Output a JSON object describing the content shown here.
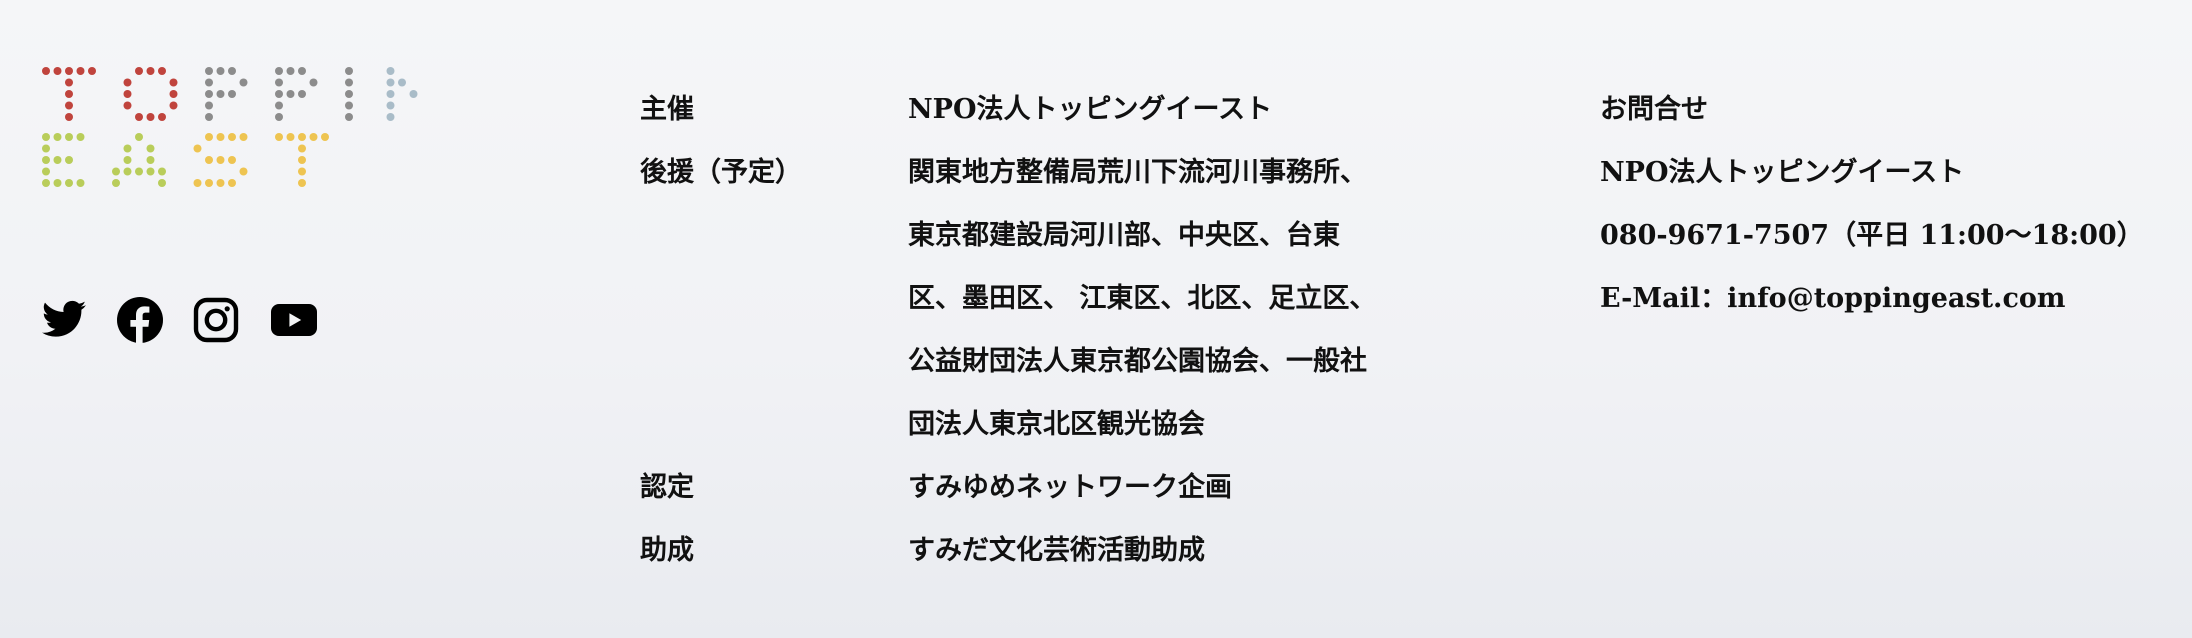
{
  "logo": {
    "line1": "TOPPING",
    "line2": "EAST",
    "colors": [
      "#c0443d",
      "#c0443d",
      "#8c8c8c",
      "#8c8c8c",
      "#8c8c8c",
      "#a9bcc8",
      "#a9bcc8",
      "#b9cd5a",
      "#b9cd5a",
      "#eec451",
      "#eec451"
    ]
  },
  "social": [
    {
      "icon": "twitter-icon"
    },
    {
      "icon": "facebook-icon"
    },
    {
      "icon": "instagram-icon"
    },
    {
      "icon": "youtube-icon"
    }
  ],
  "info": {
    "rows": [
      {
        "label": "主催",
        "lines": [
          "NPO法人トッピングイースト"
        ]
      },
      {
        "label": "後援（予定）",
        "lines": [
          "関東地方整備局荒川下流河川事務所、",
          "東京都建設局河川部、中央区、台東",
          "区、墨田区、 江東区、北区、足立区、",
          "公益財団法人東京都公園協会、一般社",
          "団法人東京北区観光協会"
        ]
      },
      {
        "label": "認定",
        "lines": [
          "すみゆめネットワーク企画"
        ]
      },
      {
        "label": "助成",
        "lines": [
          "すみだ文化芸術活動助成"
        ]
      }
    ]
  },
  "contact": {
    "heading": "お問合せ",
    "org": "NPO法人トッピングイースト",
    "phone": "080-9671-7507（平日 11:00〜18:00）",
    "email": "E-Mail：info@toppingeast.com"
  }
}
